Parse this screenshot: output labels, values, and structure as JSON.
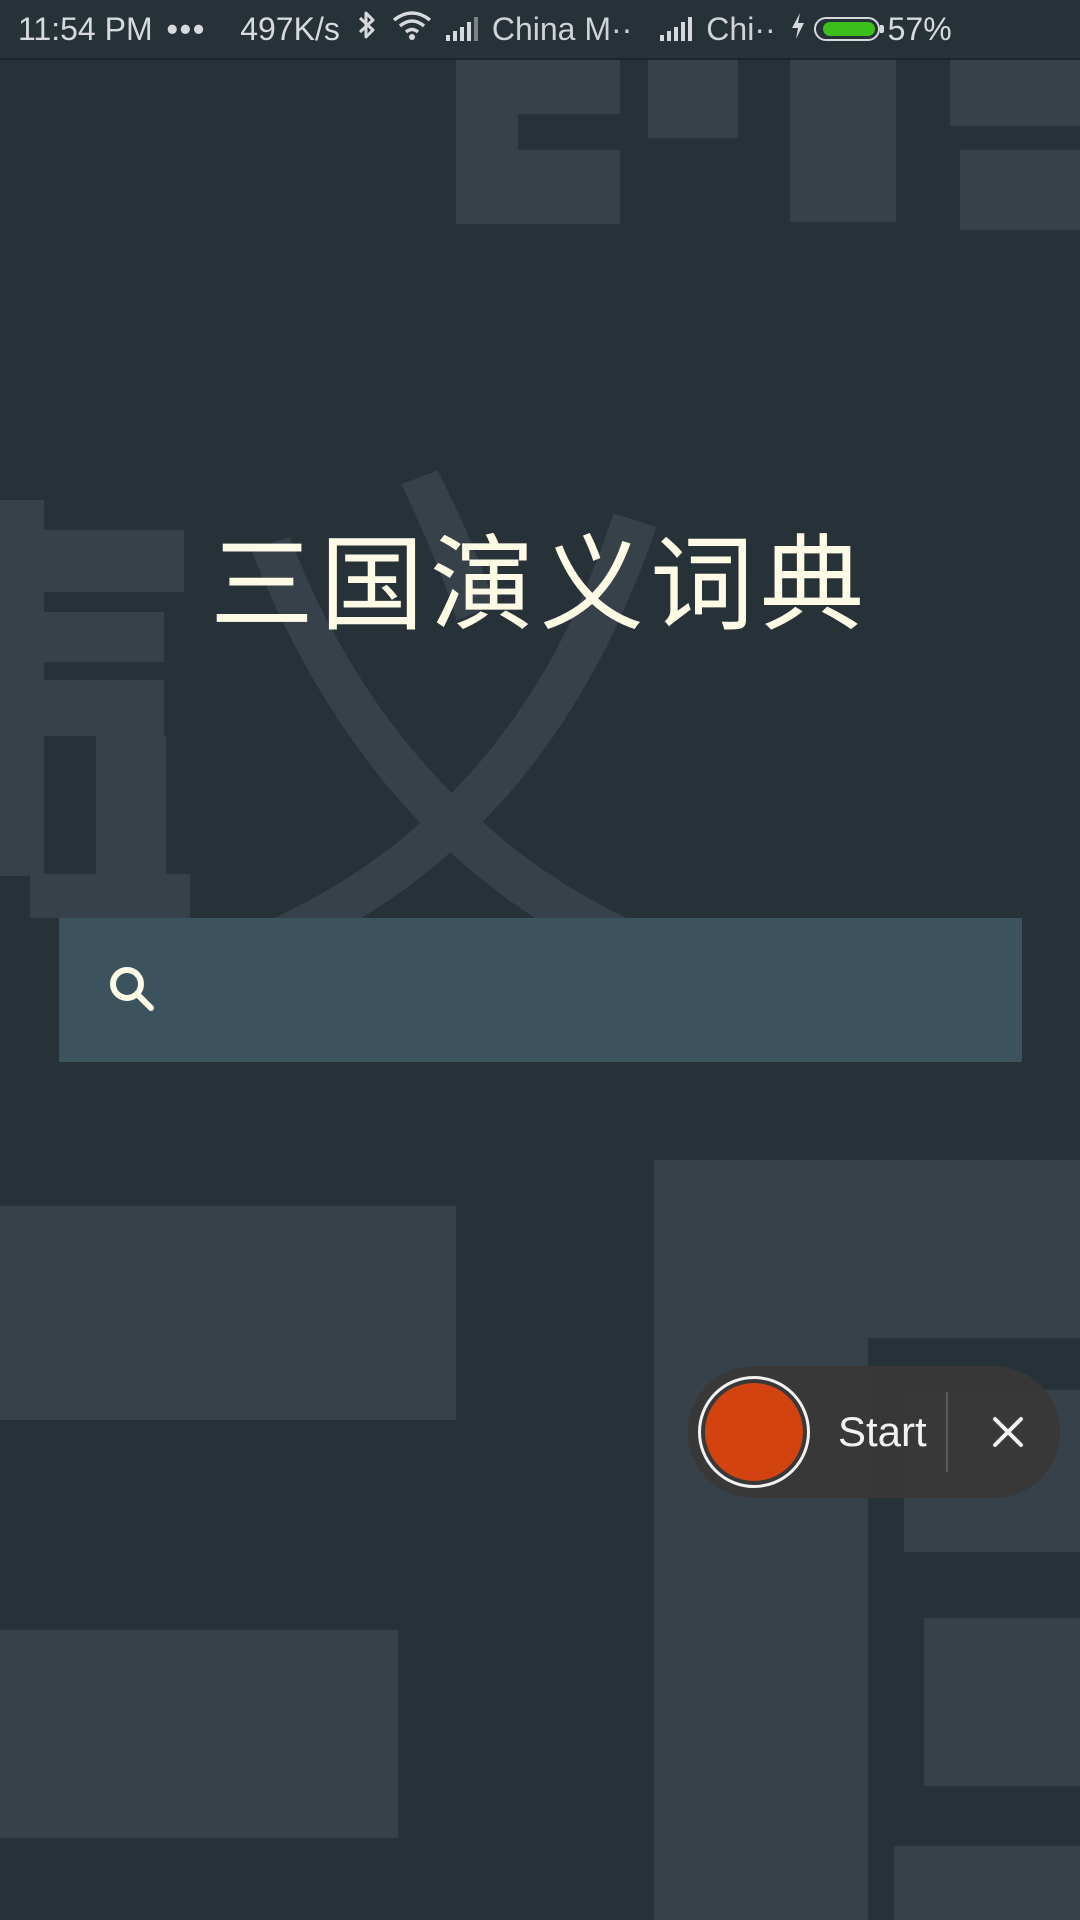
{
  "status_bar": {
    "time": "11:54 PM",
    "more_indicator": "•••",
    "network_speed": "497K/s",
    "carrier_1": "China M··",
    "carrier_2": "Chi··",
    "battery_percent": "57%",
    "battery_level": 0.57,
    "battery_color": "#3bbf1a",
    "icons": [
      "bluetooth-icon",
      "wifi-icon",
      "signal-icon",
      "charging-icon",
      "battery-icon"
    ]
  },
  "app": {
    "title": "三国演义词典",
    "background_glyph": "义",
    "background_color": "#273138"
  },
  "search": {
    "value": "",
    "placeholder": "",
    "icon": "search-icon",
    "bar_color": "#3c525d"
  },
  "recorder": {
    "start_label": "Start",
    "close_symbol": "✕",
    "record_color": "#d2430f"
  }
}
